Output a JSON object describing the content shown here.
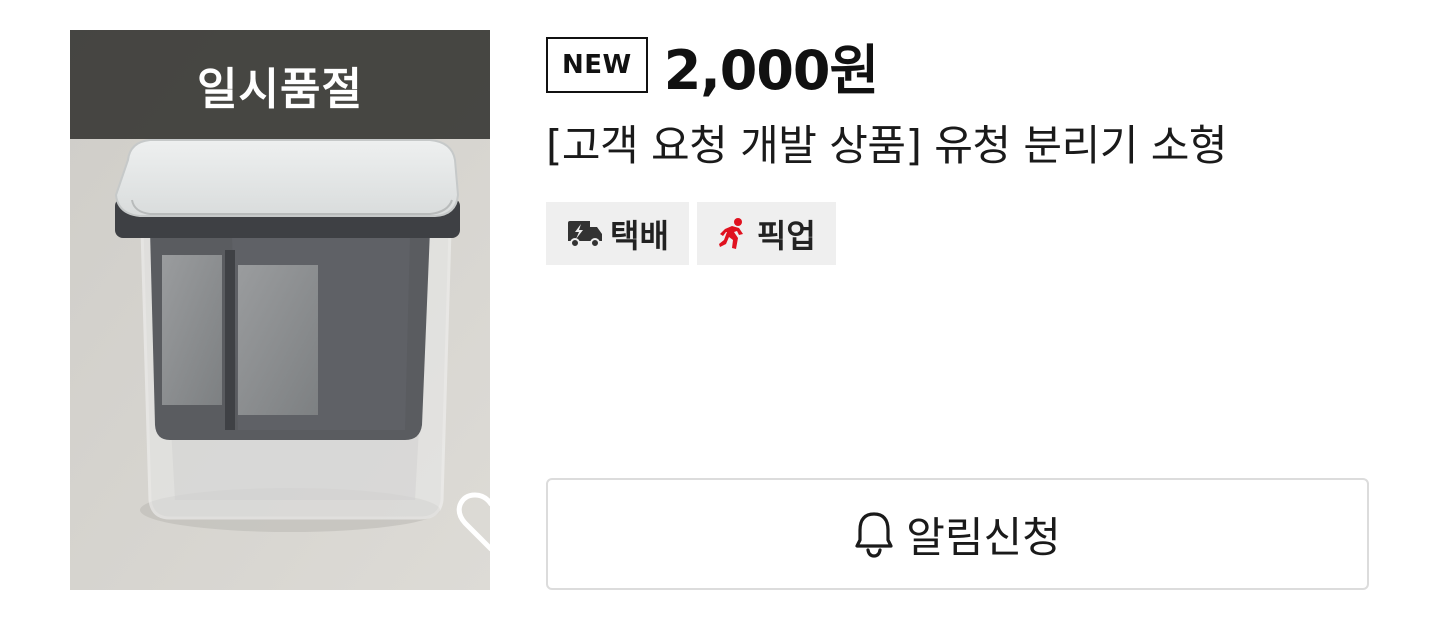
{
  "product": {
    "soldout_label": "일시품절",
    "badge": "NEW",
    "price": "2,000원",
    "name": "[고객 요청 개발 상품] 유청 분리기 소형",
    "image_alt": "유청 분리기 소형 제품 사진"
  },
  "tags": [
    {
      "label": "택배",
      "icon": "delivery-truck-icon",
      "icon_color": "#333333"
    },
    {
      "label": "픽업",
      "icon": "running-person-icon",
      "icon_color": "#e0111f"
    }
  ],
  "actions": {
    "notify_label": "알림신청",
    "notify_icon": "bell-icon",
    "wish_icon": "heart-outline-icon"
  },
  "colors": {
    "soldout_overlay": "#3a3a36",
    "tag_background": "#efefef",
    "pickup_accent": "#e0111f",
    "button_border": "#dcdcdc"
  }
}
